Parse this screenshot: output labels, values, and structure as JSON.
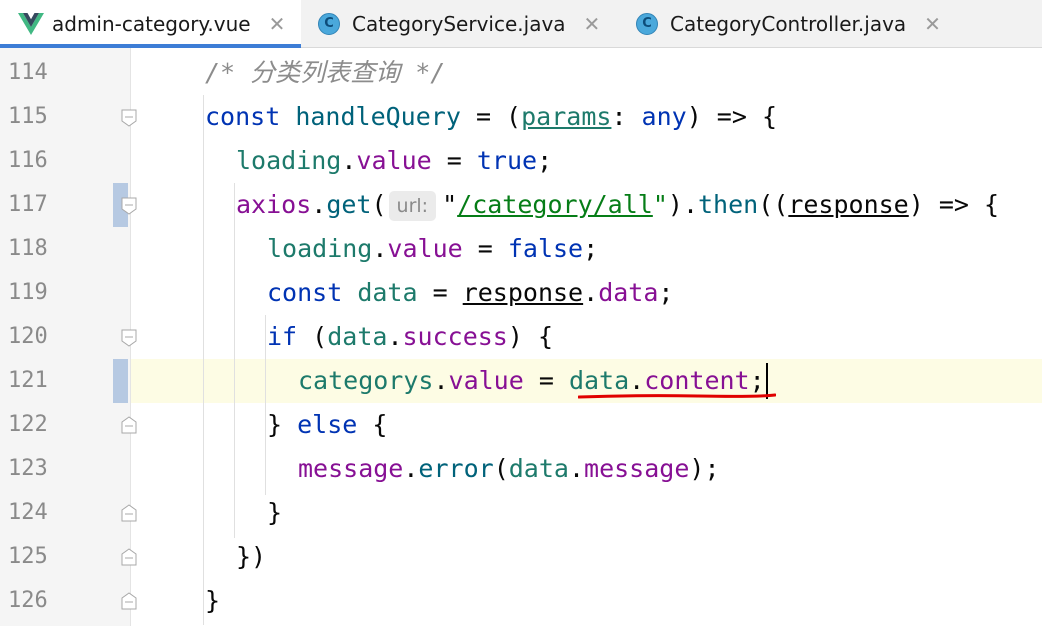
{
  "tabs": [
    {
      "label": "admin-category.vue",
      "icon": "vue-icon",
      "active": true
    },
    {
      "label": "CategoryService.java",
      "icon": "java-class-icon"
    },
    {
      "label": "CategoryController.java",
      "icon": "java-class-icon"
    }
  ],
  "tab_close_glyph": "✕",
  "class_icon_letter": "C",
  "lines": [
    {
      "no": "114",
      "tokens": [
        {
          "t": "/* 分类列表查询 */",
          "c": "cmt"
        }
      ]
    },
    {
      "no": "115",
      "tokens": [
        {
          "t": "const",
          "c": "kw"
        },
        {
          "t": " "
        },
        {
          "t": "handleQuery",
          "c": "var"
        },
        {
          "t": " = ("
        },
        {
          "t": "params",
          "c": "ul tealv"
        },
        {
          "t": ": "
        },
        {
          "t": "any",
          "c": "kw"
        },
        {
          "t": ") => {"
        }
      ]
    },
    {
      "no": "116",
      "tokens": [
        {
          "t": "loading",
          "c": "tealv"
        },
        {
          "t": "."
        },
        {
          "t": "value",
          "c": "prop"
        },
        {
          "t": " = "
        },
        {
          "t": "true",
          "c": "kw"
        },
        {
          "t": ";"
        }
      ]
    },
    {
      "no": "117",
      "tokens": [
        {
          "t": "axios",
          "c": "prop"
        },
        {
          "t": "."
        },
        {
          "t": "get",
          "c": "fn"
        },
        {
          "t": "("
        },
        {
          "hint": "url:"
        },
        {
          "t": "\""
        },
        {
          "t": "/category/all",
          "c": "str ul"
        },
        {
          "t": "\"",
          "c": "str"
        },
        {
          "t": ")."
        },
        {
          "t": "then",
          "c": "fn"
        },
        {
          "t": "(("
        },
        {
          "t": "response",
          "c": "ul"
        },
        {
          "t": ") => {"
        }
      ]
    },
    {
      "no": "118",
      "tokens": [
        {
          "t": "loading",
          "c": "tealv"
        },
        {
          "t": "."
        },
        {
          "t": "value",
          "c": "prop"
        },
        {
          "t": " = "
        },
        {
          "t": "false",
          "c": "kw"
        },
        {
          "t": ";"
        }
      ]
    },
    {
      "no": "119",
      "tokens": [
        {
          "t": "const",
          "c": "kw"
        },
        {
          "t": " "
        },
        {
          "t": "data",
          "c": "tealv"
        },
        {
          "t": " = "
        },
        {
          "t": "response",
          "c": "ul"
        },
        {
          "t": "."
        },
        {
          "t": "data",
          "c": "prop"
        },
        {
          "t": ";"
        }
      ]
    },
    {
      "no": "120",
      "tokens": [
        {
          "t": "if",
          "c": "kw"
        },
        {
          "t": " ("
        },
        {
          "t": "data",
          "c": "tealv"
        },
        {
          "t": "."
        },
        {
          "t": "success",
          "c": "prop"
        },
        {
          "t": ") {"
        }
      ]
    },
    {
      "no": "121",
      "tokens": [
        {
          "t": "categorys",
          "c": "tealv"
        },
        {
          "t": "."
        },
        {
          "t": "value",
          "c": "prop"
        },
        {
          "t": " = "
        },
        {
          "t": "data",
          "c": "tealv"
        },
        {
          "t": "."
        },
        {
          "t": "content",
          "c": "prop"
        },
        {
          "t": ";"
        }
      ]
    },
    {
      "no": "122",
      "tokens": [
        {
          "t": "} "
        },
        {
          "t": "else",
          "c": "kw"
        },
        {
          "t": " {"
        }
      ]
    },
    {
      "no": "123",
      "tokens": [
        {
          "t": "message",
          "c": "prop"
        },
        {
          "t": "."
        },
        {
          "t": "error",
          "c": "fn"
        },
        {
          "t": "("
        },
        {
          "t": "data",
          "c": "tealv"
        },
        {
          "t": "."
        },
        {
          "t": "message",
          "c": "prop"
        },
        {
          "t": ");"
        }
      ]
    },
    {
      "no": "124",
      "tokens": [
        {
          "t": "}"
        }
      ]
    },
    {
      "no": "125",
      "tokens": [
        {
          "t": "})"
        }
      ]
    },
    {
      "no": "126",
      "tokens": [
        {
          "t": "}"
        }
      ]
    }
  ],
  "colors": {
    "keyword": "#0033b3",
    "property": "#871094",
    "string": "#067d17",
    "comment": "#8c8c8c",
    "current_line": "#fdfce4",
    "annotation_underline": "#e00000",
    "active_tab_indicator": "#3d7dd6"
  }
}
